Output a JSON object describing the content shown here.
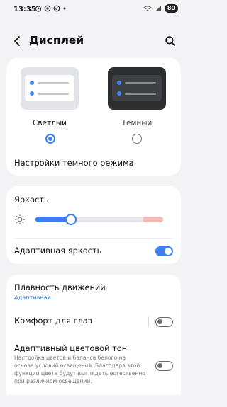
{
  "status_bar": {
    "time": "13:35",
    "battery": "80"
  },
  "header": {
    "title": "Дисплей"
  },
  "theme": {
    "light_label": "Светлый",
    "dark_label": "Темный",
    "selected": "light",
    "dark_mode_settings": "Настройки темного режима"
  },
  "brightness": {
    "label": "Яркость",
    "level": 0.28,
    "adaptive_label": "Адаптивная яркость",
    "adaptive_enabled": true
  },
  "motion": {
    "label": "Плавность движений",
    "value": "Адаптивная"
  },
  "eye_comfort": {
    "label": "Комфорт для глаз",
    "enabled": false
  },
  "adaptive_color": {
    "label": "Адаптивный цветовой тон",
    "description": "Настройка цветов и баланса белого на основе условий освещения. Благодаря этой функции цвета будут выглядеть естественно при различном освещении.",
    "enabled": false
  },
  "colors": {
    "accent": "#3d7ef0",
    "background": "#f3f3f6",
    "card": "#ffffff",
    "link": "#2f77d6"
  }
}
